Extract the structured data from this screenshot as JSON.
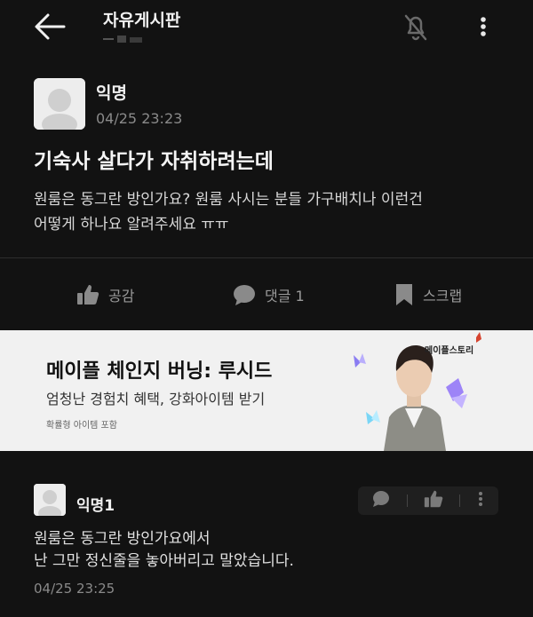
{
  "header": {
    "board_title": "자유게시판"
  },
  "post": {
    "author": "익명",
    "time": "04/25 23:23",
    "title": "기숙사 살다가 자취하려는데",
    "body_line1": "원룸은 동그란 방인가요? 원룸 사시는 분들 가구배치나 이런건",
    "body_line2": "어떻게 하나요 알려주세요 ㅠㅠ"
  },
  "actions": {
    "like_label": "공감",
    "comment_label": "댓글 1",
    "scrap_label": "스크랩"
  },
  "ad": {
    "title": "메이플 체인지 버닝: 루시드",
    "subtitle": "엄청난 경험치 혜택, 강화아이템 받기",
    "note": "확률형 아이템 포함",
    "logo": "메이플스토리"
  },
  "comment": {
    "author": "익명1",
    "body_line1": "원룸은 동그란 방인가요에서",
    "body_line2": "난 그만 정신줄을 놓아버리고 말았습니다.",
    "time": "04/25 23:25"
  },
  "colors": {
    "background": "#121212",
    "ad_background": "#f1f1f1",
    "icon_gray": "#8a8a8a"
  }
}
